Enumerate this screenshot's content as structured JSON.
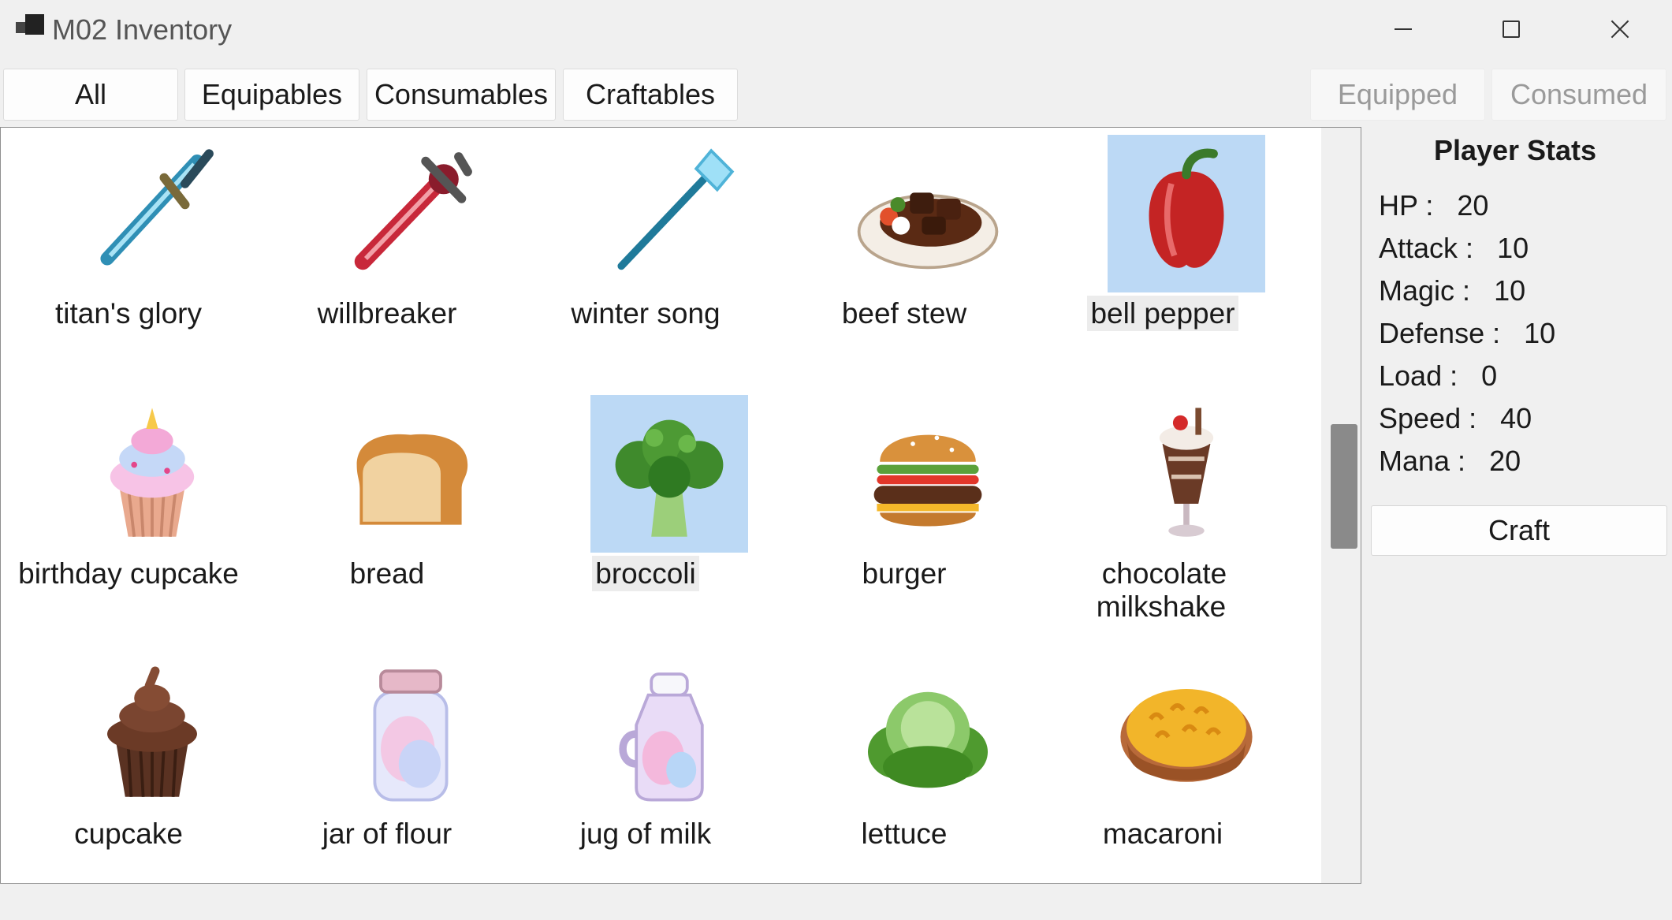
{
  "window": {
    "title": "M02 Inventory",
    "controls": [
      "minimize-icon",
      "maximize-icon",
      "close-icon"
    ]
  },
  "tabs": [
    {
      "label": "All",
      "enabled": true
    },
    {
      "label": "Equipables",
      "enabled": true
    },
    {
      "label": "Consumables",
      "enabled": true
    },
    {
      "label": "Craftables",
      "enabled": true
    },
    {
      "label": "Equipped",
      "enabled": false
    },
    {
      "label": "Consumed",
      "enabled": false
    }
  ],
  "inventory": {
    "items": [
      {
        "name": "titan's glory",
        "icon": "sword-icon",
        "selected": false
      },
      {
        "name": "willbreaker",
        "icon": "sword-icon",
        "selected": false
      },
      {
        "name": "winter song",
        "icon": "staff-icon",
        "selected": false
      },
      {
        "name": "beef stew",
        "icon": "stew-icon",
        "selected": false
      },
      {
        "name": "bell pepper",
        "icon": "pepper-icon",
        "selected": true
      },
      {
        "name": "birthday cupcake",
        "icon": "cupcake-icon",
        "selected": false
      },
      {
        "name": "bread",
        "icon": "bread-icon",
        "selected": false
      },
      {
        "name": "broccoli",
        "icon": "broccoli-icon",
        "selected": true
      },
      {
        "name": "burger",
        "icon": "burger-icon",
        "selected": false
      },
      {
        "name": "chocolate milkshake",
        "icon": "milkshake-icon",
        "selected": false
      },
      {
        "name": "cupcake",
        "icon": "cupcake-icon",
        "selected": false
      },
      {
        "name": "jar of flour",
        "icon": "jar-icon",
        "selected": false
      },
      {
        "name": "jug of milk",
        "icon": "jug-icon",
        "selected": false
      },
      {
        "name": "lettuce",
        "icon": "lettuce-icon",
        "selected": false
      },
      {
        "name": "macaroni",
        "icon": "macaroni-icon",
        "selected": false
      }
    ]
  },
  "stats": {
    "title": "Player Stats",
    "rows": [
      {
        "label": "HP :",
        "value": "20"
      },
      {
        "label": "Attack :",
        "value": "10"
      },
      {
        "label": "Magic :",
        "value": "10"
      },
      {
        "label": "Defense :",
        "value": "10"
      },
      {
        "label": "Load :",
        "value": "0"
      },
      {
        "label": "Speed :",
        "value": "40"
      },
      {
        "label": "Mana :",
        "value": "20"
      }
    ],
    "craft_label": "Craft"
  },
  "colors": {
    "selection": "#bcd9f5",
    "window_bg": "#f0f0f0",
    "scroll_thumb": "#8a8a8a"
  }
}
